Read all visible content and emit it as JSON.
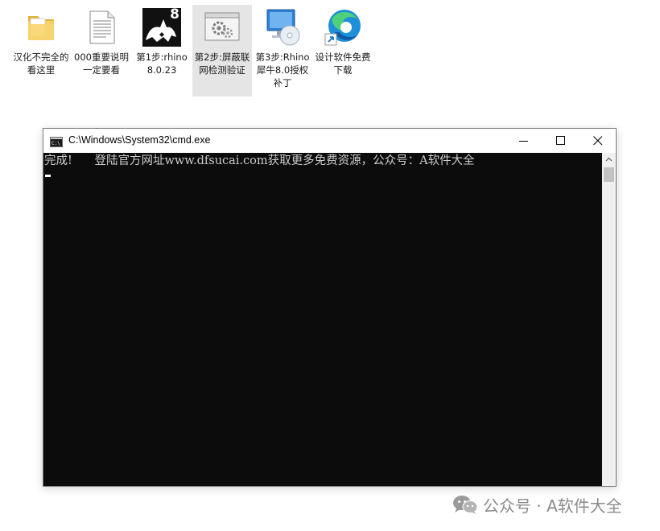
{
  "desktop": {
    "icons": [
      {
        "label": "汉化不完全的看这里",
        "icon": "folder-icon"
      },
      {
        "label": "000重要说明 一定要看",
        "icon": "text-document-icon"
      },
      {
        "label": "第1步:rhino 8.0.23",
        "icon": "rhino-8-icon",
        "badge": "8"
      },
      {
        "label": "第2步:屏蔽联网检测验证",
        "icon": "application-window-icon",
        "selected": true
      },
      {
        "label": "第3步:Rhino犀牛8.0授权补丁",
        "icon": "installer-disc-icon"
      },
      {
        "label": "设计软件免费下载",
        "icon": "edge-shortcut-icon"
      }
    ]
  },
  "cmd": {
    "title": "C:\\Windows\\System32\\cmd.exe",
    "output_line": "完成!      登陆官方网址www.dfsucai.com获取更多免费资源，公众号：A软件大全",
    "buttons": {
      "minimize": "minimize-icon",
      "maximize": "maximize-icon",
      "close": "close-icon"
    }
  },
  "watermark": {
    "text": "公众号 · A软件大全",
    "icon": "wechat-icon"
  },
  "colors": {
    "console_bg": "#0c0c0c",
    "console_text": "#cccccc",
    "selection": "#e5e5e5"
  }
}
